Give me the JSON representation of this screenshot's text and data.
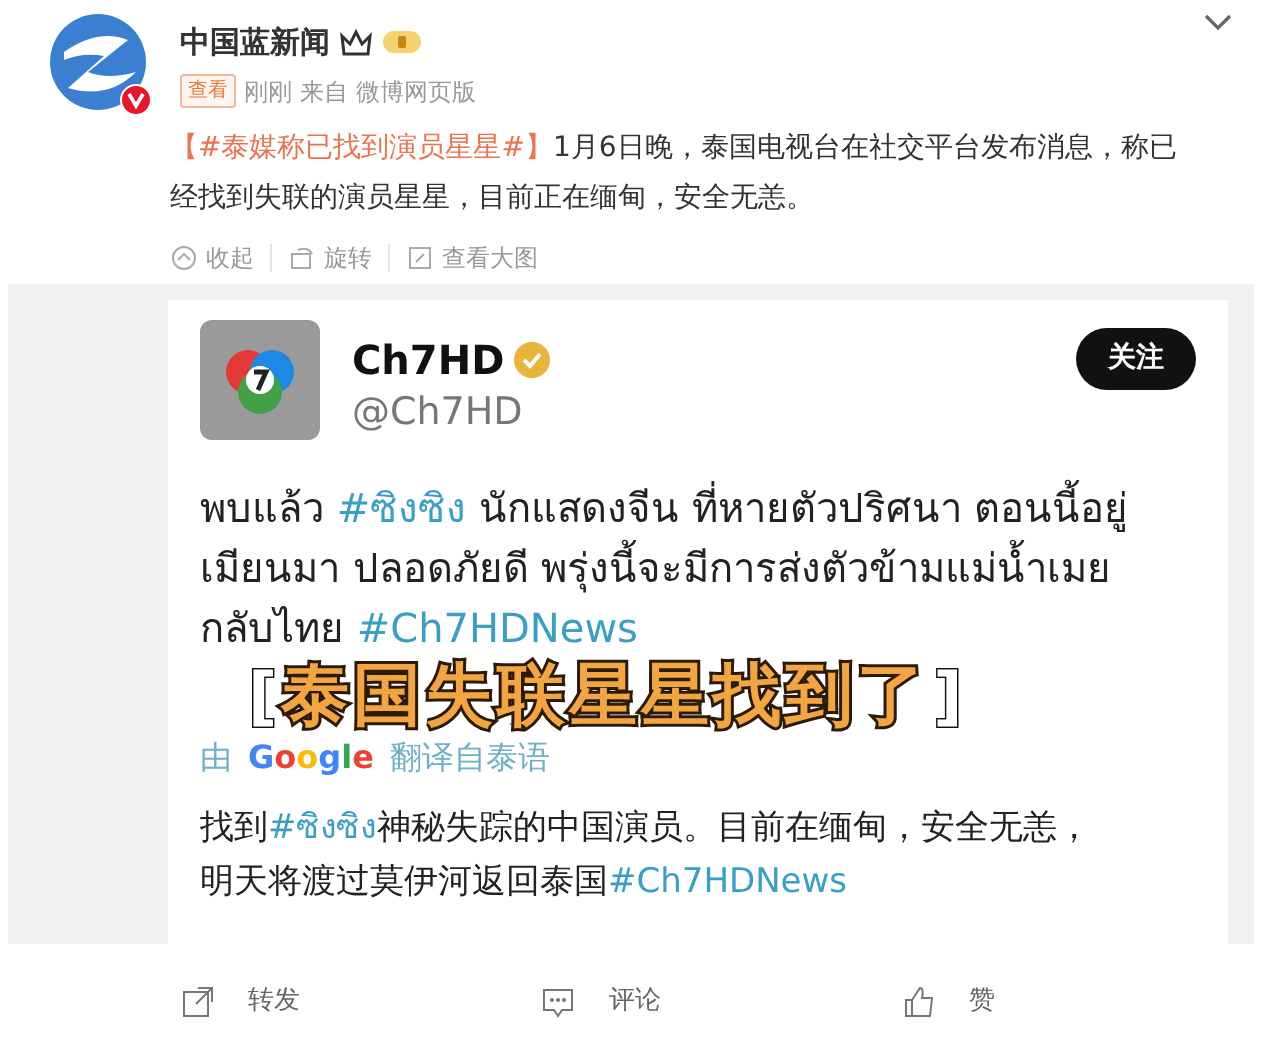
{
  "post": {
    "author": "中国蓝新闻",
    "verified": true,
    "tag": "查看",
    "time": "刚刚",
    "source_prefix": "来自",
    "source": "微博网页版",
    "text": [
      {
        "kind": "hashtag",
        "text": "【#泰媒称已找到演员星星#】"
      },
      {
        "kind": "plain",
        "text": "1月6日晚，泰国电视台在社交平台发布消息，称已经找到失联的演员星星，目前正在缅甸，安全无恙。"
      }
    ],
    "image_actions": [
      {
        "kind": "collapse",
        "label": "收起"
      },
      {
        "kind": "rotate",
        "label": "旋转"
      },
      {
        "kind": "view",
        "label": "查看大图"
      }
    ]
  },
  "image": {
    "tweet": {
      "name": "Ch7HD",
      "verified": true,
      "handle": "@Ch7HD",
      "follow_button": "关注",
      "text": [
        {
          "kind": "plain",
          "text": "พบแล้ว "
        },
        {
          "kind": "hashtag",
          "text": "#ซิงซิง"
        },
        {
          "kind": "plain",
          "text": " นักแสดงจีน ที่หายตัวปริศนา ตอนนี้อยู่เมียนมา ปลอดภัยดี พรุ่งนี้จะมีการส่งตัวข้ามแม่น้ำเมยกลับไทย "
        },
        {
          "kind": "hashtag",
          "text": "#Ch7HDNews"
        }
      ],
      "translated_by": {
        "prefix": "由",
        "brand": "Google",
        "suffix": "翻译自泰语"
      },
      "translation": [
        {
          "kind": "plain",
          "text": "找到"
        },
        {
          "kind": "hashtag",
          "text": "#ซิงซิง"
        },
        {
          "kind": "plain",
          "text": "神秘失踪的中国演员。目前在缅甸，安全无恙，明天将渡过莫伊河返回泰国"
        },
        {
          "kind": "hashtag",
          "text": "#Ch7HDNews"
        }
      ]
    },
    "caption": {
      "open": "[",
      "text": "泰国失联星星找到了",
      "close": "]"
    }
  },
  "footer": [
    {
      "kind": "repost",
      "label": "转发"
    },
    {
      "kind": "comment",
      "label": "评论"
    },
    {
      "kind": "like",
      "label": "赞"
    }
  ]
}
